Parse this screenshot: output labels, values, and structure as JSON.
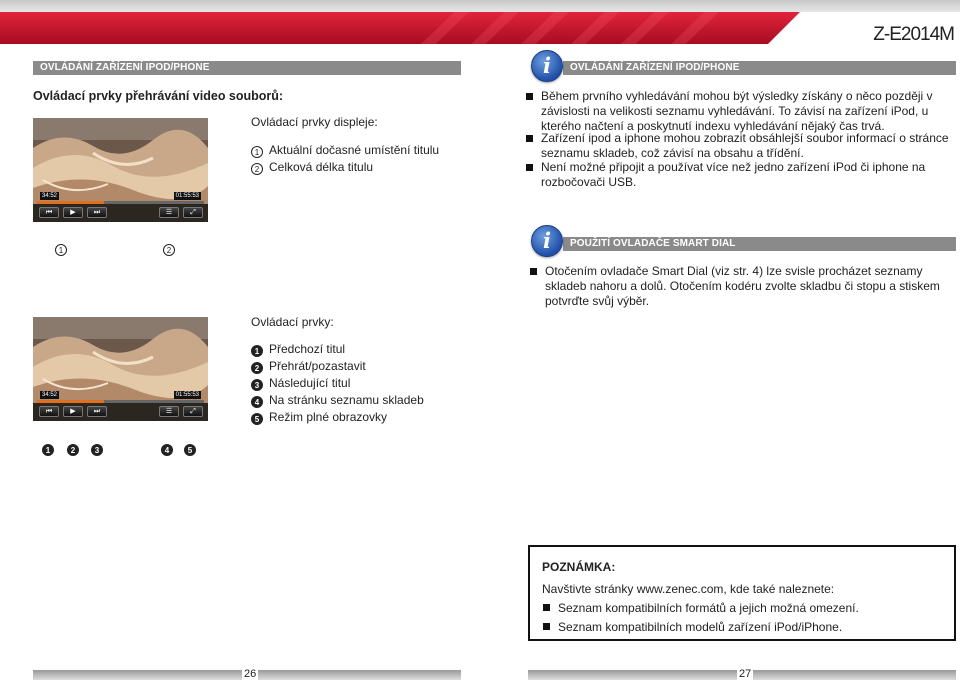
{
  "header": {
    "model": "Z-E2014M"
  },
  "left": {
    "section_bar": "OVLÁDÁNÍ ZAŘÍZENÍ IPOD/PHONE",
    "title": "Ovládací prvky přehrávání video souborů:",
    "display_heading": "Ovládací prvky displeje:",
    "display_items": [
      {
        "num": "1",
        "label": "Aktuální dočasné umístění titulu"
      },
      {
        "num": "2",
        "label": "Celková délka titulu"
      }
    ],
    "controls_heading": "Ovládací prvky:",
    "control_items": [
      {
        "num": "1",
        "label": "Předchozí titul"
      },
      {
        "num": "2",
        "label": "Přehrát/pozastavit"
      },
      {
        "num": "3",
        "label": "Následující titul"
      },
      {
        "num": "4",
        "label": "Na stránku seznamu skladeb"
      },
      {
        "num": "5",
        "label": "Režim plné obrazovky"
      }
    ],
    "screenshot": {
      "elapsed": "34:52",
      "total": "01:55:53",
      "progress_fraction": 0.4
    },
    "markers_top": [
      "1",
      "2"
    ],
    "markers_bottom": [
      "1",
      "2",
      "3",
      "4",
      "5"
    ],
    "page_number": "26"
  },
  "right": {
    "section1_bar": "OVLÁDÁNÍ ZAŘÍZENÍ IPOD/PHONE",
    "section1_bullets": [
      "Během prvního vyhledávání mohou být výsledky získány o něco později v závislosti na velikosti seznamu vyhledávání. To závisí na zařízení iPod, u kterého načtení a poskytnutí indexu vyhledávání nějaký čas trvá.",
      "Zařízení ipod a iphone mohou zobrazit obsáhlejší soubor informací o stránce seznamu skladeb, což závisí na obsahu a třídění.",
      "Není možné připojit a používat více než jedno zařízení iPod či iphone na rozbočovači USB."
    ],
    "section2_bar": "POUŽITÍ OVLADAČE SMART DIAL",
    "section2_bullets": [
      "Otočením ovladače Smart Dial (viz str. 4) lze svisle procházet seznamy skladeb nahoru a dolů. Otočením kodéru zvolte skladbu či stopu a stiskem potvrďte svůj výběr."
    ],
    "note": {
      "title": "POZNÁMKA:",
      "intro": "Navštivte stránky www.zenec.com, kde také naleznete:",
      "bullets": [
        "Seznam kompatibilních formátů a jejich možná omezení.",
        "Seznam kompatibilních modelů zařízení iPod/iPhone."
      ]
    },
    "page_number": "27"
  },
  "colors": {
    "brand_red": "#c8102e",
    "bar_gray": "#8a8a8a",
    "progress": "#e07020",
    "info_blue": "#1f4fa8"
  },
  "icons": [
    "info-icon",
    "prev-icon",
    "play-icon",
    "next-icon",
    "list-icon",
    "fullscreen-icon"
  ]
}
